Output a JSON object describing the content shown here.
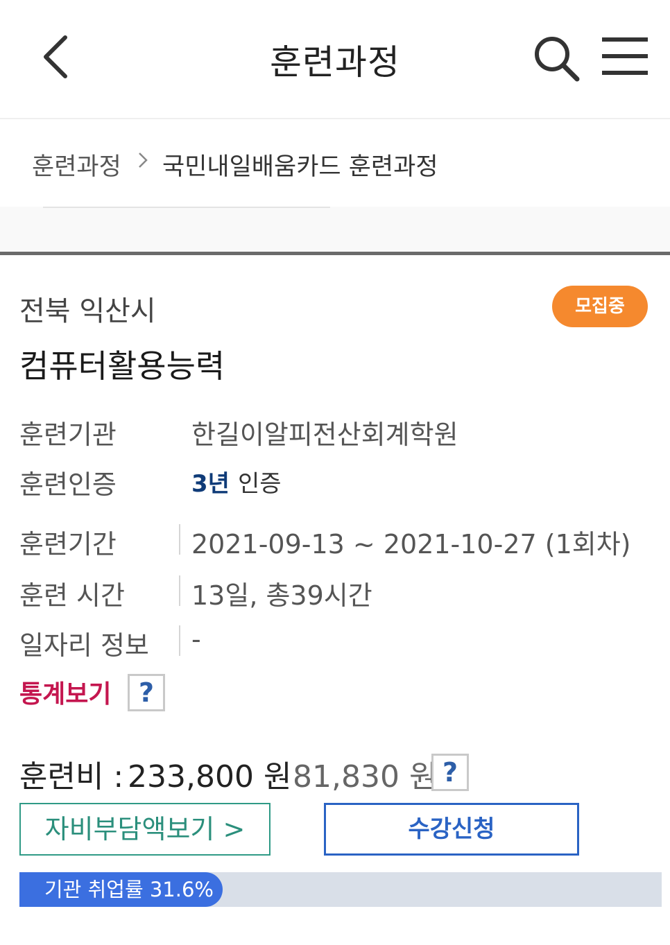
{
  "header": {
    "title": "훈련과정",
    "back_icon": "chevron-left-icon",
    "search_icon": "search-icon",
    "menu_icon": "hamburger-menu-icon"
  },
  "breadcrumb": {
    "items": [
      "훈련과정",
      "국민내일배움카드 훈련과정"
    ],
    "separator_icon": "chevron-right-icon"
  },
  "course": {
    "region": "전북 익산시",
    "status_badge": "모집중",
    "status_color": "#f5892e",
    "name": "컴퓨터활용능력",
    "institution_label": "훈련기관",
    "institution": "한길이알피전산회계학원",
    "certification_label": "훈련인증",
    "certification_years": "3년",
    "certification_text": "인증",
    "period_label": "훈련기간",
    "period": "2021-09-13 ~ 2021-10-27 (1회차)",
    "hours_label": "훈련 시간",
    "hours": "13일, 총39시간",
    "jobs_label": "일자리 정보",
    "jobs": "-",
    "stats_link": "통계보기",
    "help_mark": "?"
  },
  "fee": {
    "label": "훈련비 :",
    "amount": "233,800 원",
    "discounted": "81,830 원",
    "help_mark": "?"
  },
  "actions": {
    "self_pay": "자비부담액보기 >",
    "apply": "수강신청"
  },
  "employment": {
    "text": "기관 취업률 31.6%",
    "rate": 0.316,
    "bar_color": "#3b6fe0"
  }
}
